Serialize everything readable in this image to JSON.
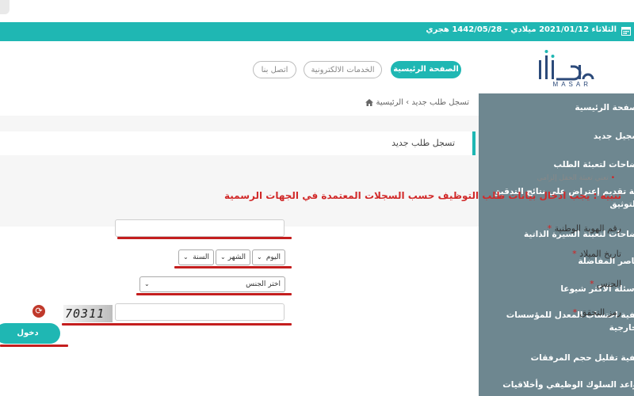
{
  "topbar": {
    "date": "الثلاثاء 2021/01/12 ميلادي - 1442/05/28 هجري",
    "calendar_icon": "calendar-icon"
  },
  "header": {
    "logo_text": "مسار",
    "logo_sub": "MASAR",
    "nav": {
      "home": "الصفحة الرئيسية",
      "eservices": "الخدمات الالكترونية",
      "contact": "اتصل بنا"
    }
  },
  "sidebar": {
    "items": [
      "الصفحة الرئيسية",
      "تسجيل جديد",
      "إيضاحات لتعبئة الطلب",
      "آلية تقديم إعتراض على نتائج التدقيق والتوثيق",
      "إيضاحات لتعبئة السيرة الذاتية",
      "عناصر المفاضلة",
      "الاسئلة الاكثر شيوعا",
      "كيفية احتساب المعدل للمؤسسات الخارجية",
      "كيفية تقليل حجم المرفقات",
      "قواعد السلوك الوظيفي وأخلاقيات"
    ]
  },
  "breadcrumb": {
    "home": "الرئيسية",
    "separator": "›",
    "current": "تسجل طلب جديد",
    "icon": "home-icon"
  },
  "form": {
    "title": "تسجل طلب جديد",
    "required_note": "تعني تعبئة الحقل إلزامي",
    "required_dot": "•",
    "warning": "تنبيه : يجب ادخال بيانات طلب التوظيف حسب السجلات المعتمدة في الجهات الرسمية",
    "national_id_label": "رقم الهوية الوطنية",
    "national_id_value": "",
    "dob_label": "تاريخ الميلاد",
    "day_placeholder": "اليوم",
    "month_placeholder": "الشهر",
    "year_placeholder": "السنة",
    "gender_label": "الجنس",
    "gender_placeholder": "اختر الجنس",
    "captcha_label": "رمز التحقق",
    "captcha_value": "",
    "captcha_text": "70311",
    "star": "*",
    "login_button": "دخول",
    "refresh_icon": "refresh-icon"
  },
  "colors": {
    "accent": "#1fb7b3",
    "sidebar": "#6e8790",
    "warning": "#d12a2a",
    "annotation": "#c41e1e"
  }
}
